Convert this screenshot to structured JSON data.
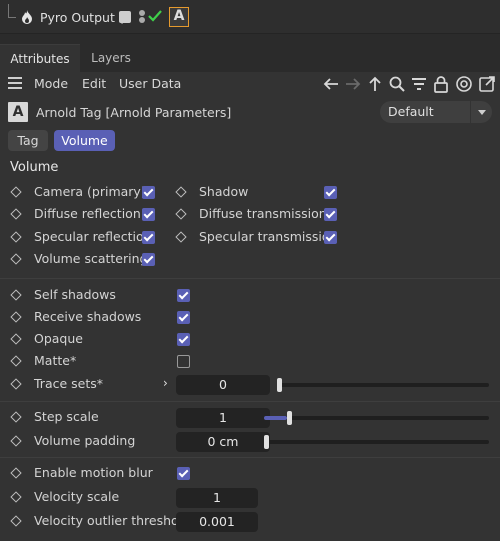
{
  "object_bar": {
    "object_name": "Pyro Output (",
    "accent_color": "#e59a2e",
    "tags": [
      "display-tag-icon",
      "phong-dots-icon",
      "enabled-check-icon",
      "arnold-tag-icon"
    ],
    "arnold_letter": "A"
  },
  "tabs": [
    {
      "label": "Attributes",
      "active": true
    },
    {
      "label": "Layers",
      "active": false
    }
  ],
  "menubar": {
    "items": [
      "Mode",
      "Edit",
      "User Data"
    ],
    "icons": [
      "back-arrow-icon",
      "forward-arrow-icon",
      "up-arrow-icon",
      "search-icon",
      "filter-icon",
      "lock-icon",
      "target-icon",
      "new-window-icon"
    ]
  },
  "title": {
    "logo_letter": "A",
    "name": "Arnold Tag [Arnold Parameters]",
    "preset": "Default"
  },
  "subtabs": [
    {
      "label": "Tag",
      "active": false
    },
    {
      "label": "Volume",
      "active": true
    }
  ],
  "section": {
    "title": "Volume",
    "visibility_left": [
      {
        "label": "Camera (primary)",
        "checked": true
      },
      {
        "label": "Diffuse reflection",
        "checked": true
      },
      {
        "label": "Specular reflection",
        "checked": true
      },
      {
        "label": "Volume scattering",
        "checked": true
      }
    ],
    "visibility_right": [
      {
        "label": "Shadow",
        "checked": true
      },
      {
        "label": "Diffuse transmission",
        "checked": true
      },
      {
        "label": "Specular transmission",
        "checked": true
      }
    ],
    "shadows": [
      {
        "label": "Self shadows",
        "checked": true
      },
      {
        "label": "Receive shadows",
        "checked": true
      },
      {
        "label": "Opaque",
        "checked": true
      },
      {
        "label": "Matte*",
        "checked": false
      }
    ],
    "trace_sets": {
      "label": "Trace sets*",
      "value": "0",
      "slider_fraction": 0.0
    },
    "step_scale": {
      "label": "Step scale",
      "value": "1",
      "slider_fraction": 0.1
    },
    "volume_padding": {
      "label": "Volume padding",
      "value": "0 cm",
      "slider_fraction": 0.0
    },
    "motion": {
      "enable": {
        "label": "Enable motion blur",
        "checked": true
      },
      "velocity_scale": {
        "label": "Velocity scale",
        "value": "1"
      },
      "velocity_outlier": {
        "label": "Velocity outlier threshold",
        "value": "0.001"
      }
    }
  },
  "colors": {
    "accent": "#5a60b5",
    "background": "#333333"
  }
}
